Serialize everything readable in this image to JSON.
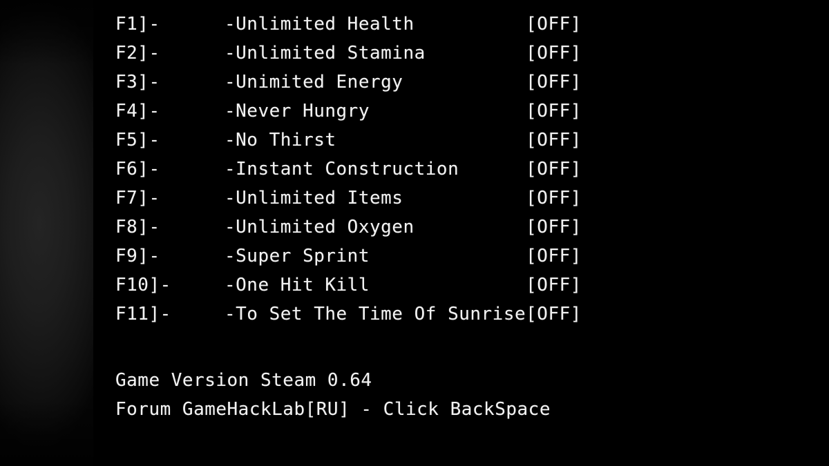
{
  "panel": {
    "background_color": "#000000",
    "text_color": "#f2f2f2",
    "backdrop_color": "#1d1d1d"
  },
  "cheat_list": {
    "rows": [
      {
        "key": "F1]-",
        "description": "-Unlimited Health",
        "state": "[OFF]"
      },
      {
        "key": "F2]-",
        "description": "-Unlimited Stamina",
        "state": "[OFF]"
      },
      {
        "key": "F3]-",
        "description": "-Unimited Energy",
        "state": "[OFF]"
      },
      {
        "key": "F4]-",
        "description": "-Never Hungry",
        "state": "[OFF]"
      },
      {
        "key": "F5]-",
        "description": "-No Thirst",
        "state": "[OFF]"
      },
      {
        "key": "F6]-",
        "description": "-Instant Construction",
        "state": "[OFF]"
      },
      {
        "key": "F7]-",
        "description": "-Unlimited Items",
        "state": "[OFF]"
      },
      {
        "key": "F8]-",
        "description": "-Unlimited Oxygen",
        "state": "[OFF]"
      },
      {
        "key": "F9]-",
        "description": "-Super Sprint",
        "state": "[OFF]"
      },
      {
        "key": "F10]-",
        "description": "-One Hit Kill",
        "state": "[OFF]"
      },
      {
        "key": "F11]-",
        "description": "-To Set The Time Of Sunrise",
        "state": "[OFF]"
      }
    ]
  },
  "footer": {
    "version_line": "Game Version Steam 0.64",
    "forum_line": "Forum GameHackLab[RU] - Click BackSpace"
  }
}
